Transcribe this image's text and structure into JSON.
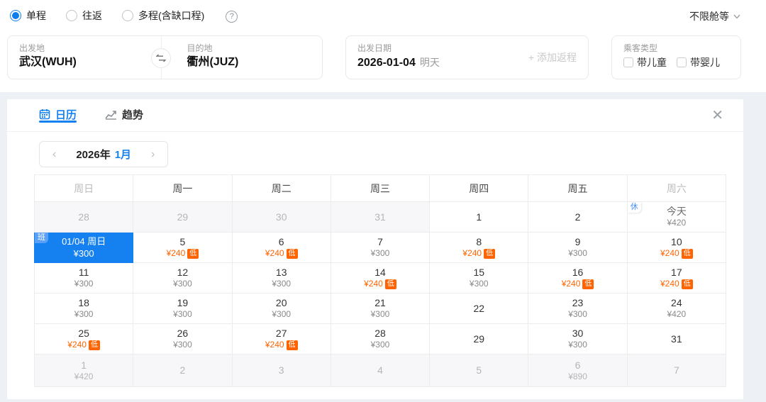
{
  "trip_type": {
    "options": [
      {
        "key": "oneway",
        "label": "单程",
        "selected": true
      },
      {
        "key": "roundtrip",
        "label": "往返",
        "selected": false
      },
      {
        "key": "multicity",
        "label": "多程(含缺口程)",
        "selected": false
      }
    ],
    "help_glyph": "?"
  },
  "cabin_class": {
    "label": "不限舱等"
  },
  "search": {
    "from": {
      "label": "出发地",
      "value": "武汉(WUH)"
    },
    "to": {
      "label": "目的地",
      "value": "衢州(JUZ)"
    },
    "date": {
      "label": "出发日期",
      "value": "2026-01-04",
      "hint": "明天"
    },
    "add_return": "+ 添加返程",
    "passenger": {
      "label": "乘客类型",
      "options": [
        {
          "key": "child",
          "label": "带儿童",
          "checked": false
        },
        {
          "key": "infant",
          "label": "带婴儿",
          "checked": false
        }
      ]
    }
  },
  "panel": {
    "tabs": [
      {
        "key": "calendar",
        "label": "日历",
        "active": true
      },
      {
        "key": "trend",
        "label": "趋势",
        "active": false
      }
    ],
    "close_glyph": "✕",
    "month_nav": {
      "prev": "‹",
      "year": "2026年",
      "month": "1月",
      "next": "›"
    },
    "calendar": {
      "weekdays": [
        {
          "label": "周日",
          "muted": true
        },
        {
          "label": "周一"
        },
        {
          "label": "周二"
        },
        {
          "label": "周三"
        },
        {
          "label": "周四"
        },
        {
          "label": "周五"
        },
        {
          "label": "周六",
          "muted": true
        }
      ],
      "low_badge": "低",
      "rows": [
        [
          {
            "day": "28",
            "muted": true
          },
          {
            "day": "29",
            "muted": true
          },
          {
            "day": "30",
            "muted": true
          },
          {
            "day": "31",
            "muted": true
          },
          {
            "day": "1"
          },
          {
            "day": "2"
          },
          {
            "day": "今天",
            "price": "¥420",
            "corner": "休",
            "today": true
          }
        ],
        [
          {
            "selected": true,
            "corner": "班",
            "label": "01/04 周日",
            "price": "¥300"
          },
          {
            "day": "5",
            "price": "¥240",
            "low": true
          },
          {
            "day": "6",
            "price": "¥240",
            "low": true
          },
          {
            "day": "7",
            "price": "¥300"
          },
          {
            "day": "8",
            "price": "¥240",
            "low": true
          },
          {
            "day": "9",
            "price": "¥300"
          },
          {
            "day": "10",
            "price": "¥240",
            "low": true
          }
        ],
        [
          {
            "day": "11",
            "price": "¥300"
          },
          {
            "day": "12",
            "price": "¥300"
          },
          {
            "day": "13",
            "price": "¥300"
          },
          {
            "day": "14",
            "price": "¥240",
            "low": true
          },
          {
            "day": "15",
            "price": "¥300"
          },
          {
            "day": "16",
            "price": "¥240",
            "low": true
          },
          {
            "day": "17",
            "price": "¥240",
            "low": true
          }
        ],
        [
          {
            "day": "18",
            "price": "¥300"
          },
          {
            "day": "19",
            "price": "¥300"
          },
          {
            "day": "20",
            "price": "¥300"
          },
          {
            "day": "21",
            "price": "¥300"
          },
          {
            "day": "22"
          },
          {
            "day": "23",
            "price": "¥300"
          },
          {
            "day": "24",
            "price": "¥420"
          }
        ],
        [
          {
            "day": "25",
            "price": "¥240",
            "low": true
          },
          {
            "day": "26",
            "price": "¥300"
          },
          {
            "day": "27",
            "price": "¥240",
            "low": true
          },
          {
            "day": "28",
            "price": "¥300"
          },
          {
            "day": "29"
          },
          {
            "day": "30",
            "price": "¥300"
          },
          {
            "day": "31"
          }
        ],
        [
          {
            "day": "1",
            "price": "¥420",
            "muted": true
          },
          {
            "day": "2",
            "muted": true
          },
          {
            "day": "3",
            "muted": true
          },
          {
            "day": "4",
            "muted": true
          },
          {
            "day": "5",
            "muted": true
          },
          {
            "day": "6",
            "price": "¥890",
            "muted": true
          },
          {
            "day": "7",
            "muted": true
          }
        ]
      ]
    }
  },
  "colors": {
    "accent_blue": "#1581f0",
    "low_price_orange": "#ff6400"
  }
}
